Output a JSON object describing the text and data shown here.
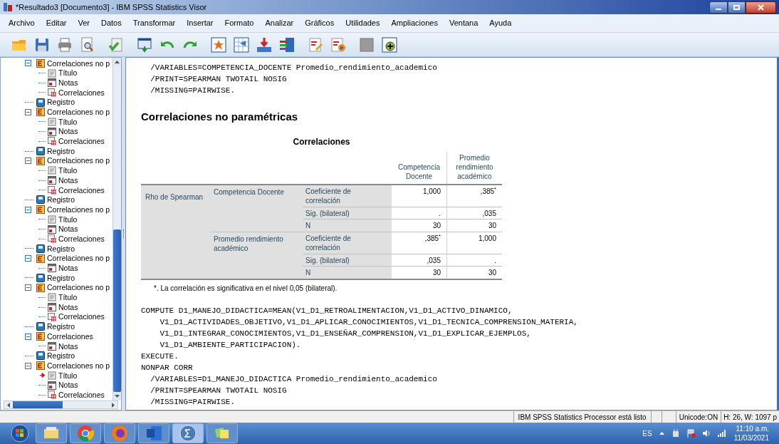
{
  "window": {
    "title": "*Resultado3 [Documento3] - IBM SPSS Statistics Visor"
  },
  "menu": [
    "Archivo",
    "Editar",
    "Ver",
    "Datos",
    "Transformar",
    "Insertar",
    "Formato",
    "Analizar",
    "Gráficos",
    "Utilidades",
    "Ampliaciones",
    "Ventana",
    "Ayuda"
  ],
  "tree": [
    {
      "kind": "output",
      "label": "Correlaciones no p",
      "expanded": true,
      "children": [
        {
          "kind": "title",
          "label": "Título",
          "current": false
        },
        {
          "kind": "notes",
          "label": "Notas",
          "current": false
        },
        {
          "kind": "table",
          "label": "Correlaciones",
          "current": false
        }
      ]
    },
    {
      "kind": "log",
      "label": "Registro"
    },
    {
      "kind": "output",
      "label": "Correlaciones no p",
      "expanded": true,
      "children": [
        {
          "kind": "title",
          "label": "Título",
          "current": false
        },
        {
          "kind": "notes",
          "label": "Notas",
          "current": false
        },
        {
          "kind": "table",
          "label": "Correlaciones",
          "current": false
        }
      ]
    },
    {
      "kind": "log",
      "label": "Registro"
    },
    {
      "kind": "output",
      "label": "Correlaciones no p",
      "expanded": true,
      "children": [
        {
          "kind": "title",
          "label": "Título",
          "current": false
        },
        {
          "kind": "notes",
          "label": "Notas",
          "current": false
        },
        {
          "kind": "table",
          "label": "Correlaciones",
          "current": false
        }
      ]
    },
    {
      "kind": "log",
      "label": "Registro"
    },
    {
      "kind": "output",
      "label": "Correlaciones no p",
      "expanded": true,
      "children": [
        {
          "kind": "title",
          "label": "Título",
          "current": false
        },
        {
          "kind": "notes",
          "label": "Notas",
          "current": false
        },
        {
          "kind": "table",
          "label": "Correlaciones",
          "current": false
        }
      ]
    },
    {
      "kind": "log",
      "label": "Registro"
    },
    {
      "kind": "output",
      "label": "Correlaciones no p",
      "expanded": true,
      "children": [
        {
          "kind": "notes",
          "label": "Notas",
          "current": false
        }
      ]
    },
    {
      "kind": "log",
      "label": "Registro"
    },
    {
      "kind": "output",
      "label": "Correlaciones no p",
      "expanded": true,
      "children": [
        {
          "kind": "title",
          "label": "Título",
          "current": false
        },
        {
          "kind": "notes",
          "label": "Notas",
          "current": false
        },
        {
          "kind": "table",
          "label": "Correlaciones",
          "current": false
        }
      ]
    },
    {
      "kind": "log",
      "label": "Registro"
    },
    {
      "kind": "output",
      "label": "Correlaciones",
      "expanded": true,
      "children": [
        {
          "kind": "notes",
          "label": "Notas",
          "current": false
        }
      ]
    },
    {
      "kind": "log",
      "label": "Registro"
    },
    {
      "kind": "output",
      "label": "Correlaciones no p",
      "expanded": true,
      "children": [
        {
          "kind": "title",
          "label": "Título",
          "current": true
        },
        {
          "kind": "notes",
          "label": "Notas",
          "current": false
        },
        {
          "kind": "table",
          "label": "Correlaciones",
          "current": false
        }
      ]
    }
  ],
  "syntax_top": [
    "  /VARIABLES=COMPETENCIA_DOCENTE Promedio_rendimiento_academico",
    "  /PRINT=SPEARMAN TWOTAIL NOSIG",
    "  /MISSING=PAIRWISE."
  ],
  "heading": "Correlaciones no paramétricas",
  "table": {
    "title": "Correlaciones",
    "columns": [
      "Competencia Docente",
      "Promedio rendimiento académico"
    ],
    "group": "Rho de Spearman",
    "variables": [
      {
        "label": "Competencia Docente",
        "stats": [
          {
            "label": "Coeficiente de correlación",
            "values": [
              "1,000",
              ",385$^{*}$"
            ]
          },
          {
            "label": "Sig. (bilateral)",
            "values": [
              ".",
              ",035"
            ]
          },
          {
            "label": "N",
            "values": [
              "30",
              "30"
            ]
          }
        ]
      },
      {
        "label": "Promedio rendimiento académico",
        "stats": [
          {
            "label": "Coeficiente de correlación",
            "values": [
              ",385$^{*}$",
              "1,000"
            ]
          },
          {
            "label": "Sig. (bilateral)",
            "values": [
              ",035",
              "."
            ]
          },
          {
            "label": "N",
            "values": [
              "30",
              "30"
            ]
          }
        ]
      }
    ],
    "footnote": "*. La correlación es significativa en el nivel 0,05 (bilateral)."
  },
  "syntax_bottom": [
    "COMPUTE D1_MANEJO_DIDACTICA=MEAN(V1_D1_RETROALIMENTACION,V1_D1_ACTIVO_DINAMICO,",
    "    V1_D1_ACTIVIDADES_OBJETIVO,V1_D1_APLICAR_CONOCIMIENTOS,V1_D1_TECNICA_COMPRENSION_MATERIA,",
    "    V1_D1_INTEGRAR_CONOCIMIENTOS,V1_D1_ENSEÑAR_COMPRENSION,V1_D1_EXPLICAR_EJEMPLOS,",
    "    V1_D1_AMBIENTE_PARTICIPACION).",
    "EXECUTE.",
    "NONPAR CORR",
    "  /VARIABLES=D1_MANEJO_DIDACTICA Promedio_rendimiento_academico",
    "  /PRINT=SPEARMAN TWOTAIL NOSIG",
    "  /MISSING=PAIRWISE."
  ],
  "status_bar": [
    "IBM SPSS Statistics Processor está listo",
    "Unicode:ON",
    "H: 26, W: 1097 p"
  ],
  "taskbar": {
    "language": "ES",
    "time": "11:10 a.m.",
    "date": "11/03/2021"
  }
}
